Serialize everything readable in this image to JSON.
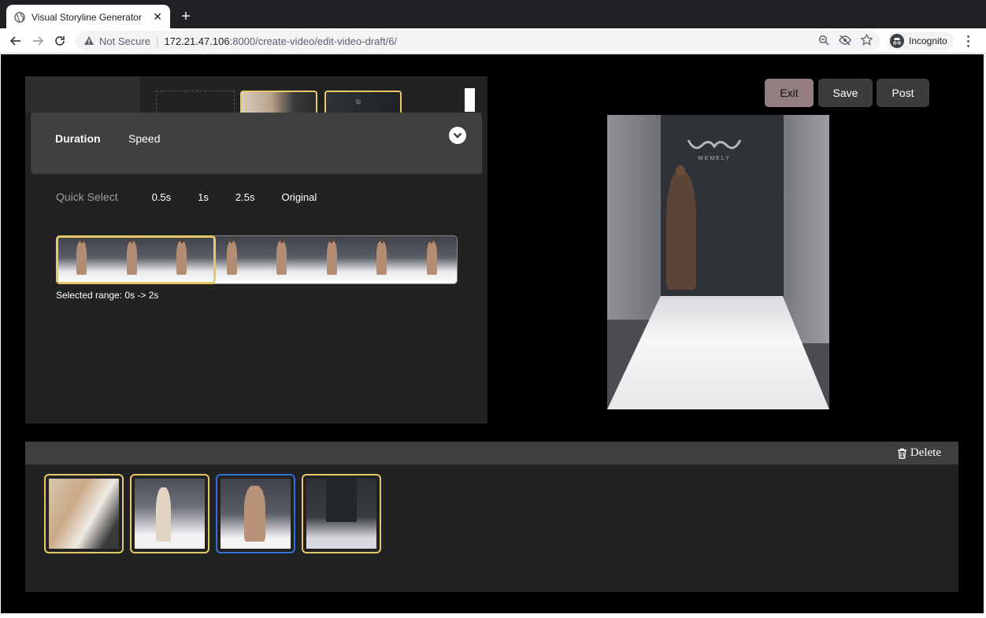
{
  "browser": {
    "tab_title": "Visual Storyline Generator",
    "new_tab": "+",
    "tab_close": "✕",
    "not_secure": "Not Secure",
    "url_host": "172.21.47.106",
    "url_path": ":8000/create-video/edit-video-draft/6/",
    "profile_label": "Incognito"
  },
  "editor": {
    "tabs": [
      "Duration",
      "Speed"
    ],
    "quick_select_label": "Quick Select",
    "quick_options": [
      "0.5s",
      "1s",
      "2.5s",
      "Original"
    ],
    "selected_range_label": "Selected range:  0s -> 2s"
  },
  "actions": {
    "exit": "Exit",
    "save": "Save",
    "post": "Post"
  },
  "preview": {
    "brand_text": "WEMELY"
  },
  "timeline": {
    "delete_label": "Delete",
    "active_clip": 3
  },
  "colors": {
    "accent_selected": "#e8c766",
    "active_clip_border": "#2f6fd6",
    "exit_button": "#937f80"
  }
}
